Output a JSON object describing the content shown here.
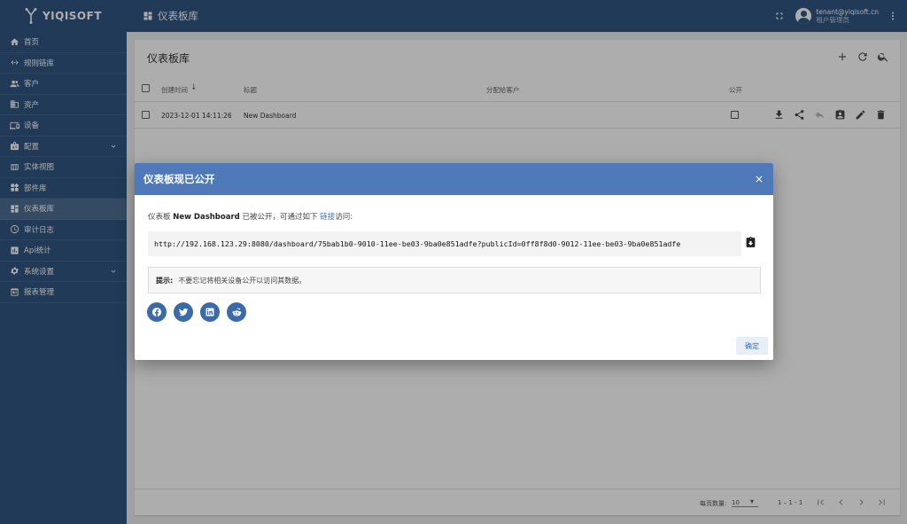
{
  "app": {
    "brand": "YIQISOFT"
  },
  "sidebar": {
    "items": [
      {
        "label": "首页",
        "icon": "home-icon"
      },
      {
        "label": "规则链库",
        "icon": "rule-chain-icon"
      },
      {
        "label": "客户",
        "icon": "customers-icon"
      },
      {
        "label": "资产",
        "icon": "assets-icon"
      },
      {
        "label": "设备",
        "icon": "devices-icon"
      },
      {
        "label": "配置",
        "icon": "profiles-icon"
      },
      {
        "label": "实体视图",
        "icon": "entity-view-icon"
      },
      {
        "label": "部件库",
        "icon": "widgets-icon"
      },
      {
        "label": "仪表板库",
        "icon": "dashboard-icon"
      },
      {
        "label": "审计日志",
        "icon": "audit-log-icon"
      },
      {
        "label": "Api统计",
        "icon": "api-stats-icon"
      },
      {
        "label": "系统设置",
        "icon": "settings-icon"
      },
      {
        "label": "报表管理",
        "icon": "report-icon"
      }
    ]
  },
  "topbar": {
    "title": "仪表板库",
    "user_email": "tenant@yiqisoft.cn",
    "user_role": "租户管理员"
  },
  "page": {
    "title": "仪表板库",
    "columns": {
      "created": "创建时间",
      "title": "标题",
      "assigned": "分配给客户",
      "public": "公开"
    },
    "rows": [
      {
        "created": "2023-12-01 14:11:26",
        "title": "New Dashboard",
        "assigned": "",
        "public": false
      }
    ],
    "footer": {
      "per_page_label": "每页数量:",
      "per_page_value": "10",
      "range": "1 – 1 - 1"
    }
  },
  "dialog": {
    "title": "仪表板现已公开",
    "msg_prefix": "仪表板",
    "dashboard_name": "New Dashboard",
    "msg_mid": "已被公开，可通过如下",
    "link_text": "链接",
    "msg_suffix": "访问:",
    "url": "http://192.168.123.29:8080/dashboard/75bab1b0-9010-11ee-be03-9ba0e851adfe?publicId=0ff8f8d0-9012-11ee-be03-9ba0e851adfe",
    "hint_label": "提示:",
    "hint_text": "不要忘记将相关设备公开以访问其数据。",
    "share": [
      "facebook-icon",
      "twitter-icon",
      "linkedin-icon",
      "reddit-icon"
    ],
    "ok_label": "确定"
  },
  "colors": {
    "primary": "#305680",
    "dialog_header": "#4f79b9",
    "link": "#3f6fb5"
  }
}
